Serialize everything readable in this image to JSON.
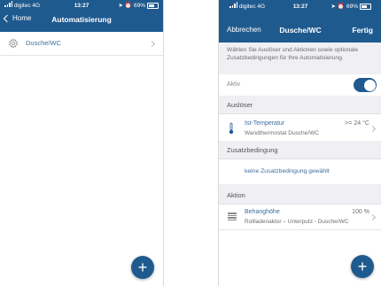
{
  "left_screen": {
    "status": {
      "carrier": "digitec",
      "network": "4G",
      "time": "13:27",
      "battery": "69%"
    },
    "nav": {
      "back_label": "Home",
      "title": "Automatisierung"
    },
    "list": [
      {
        "label": "Dusche/WC"
      }
    ],
    "fab_symbol": "+"
  },
  "right_screen": {
    "status": {
      "carrier": "digitec",
      "network": "4G",
      "time": "13:27",
      "battery": "69%"
    },
    "nav": {
      "cancel_label": "Abbrechen",
      "title": "Dusche/WC",
      "done_label": "Fertig"
    },
    "intro": "Wählen Sie Auslöser und Aktionen sowie optionale Zusatzbedingungen für Ihre Automatisierung.",
    "aktiv": {
      "label": "Aktiv",
      "on": true
    },
    "trigger_section": {
      "header": "Auslöser",
      "item": {
        "title": "Ist-Temperatur",
        "subtitle": "Wandthermostat Dusche/WC",
        "value": ">= 24 °C"
      }
    },
    "condition_section": {
      "header": "Zusatzbedingung",
      "empty_text": "keine Zusatzbedingung gewählt"
    },
    "action_section": {
      "header": "Aktion",
      "item": {
        "title": "Behanghöhe",
        "subtitle": "Rollladenaktor – Unterputz - Dusche/WC",
        "value": "100 %"
      }
    },
    "fab_symbol": "+"
  },
  "colors": {
    "nav_blue": "#1f5a8f",
    "link_blue": "#3a6e9c",
    "section_gray": "#efeff4"
  }
}
